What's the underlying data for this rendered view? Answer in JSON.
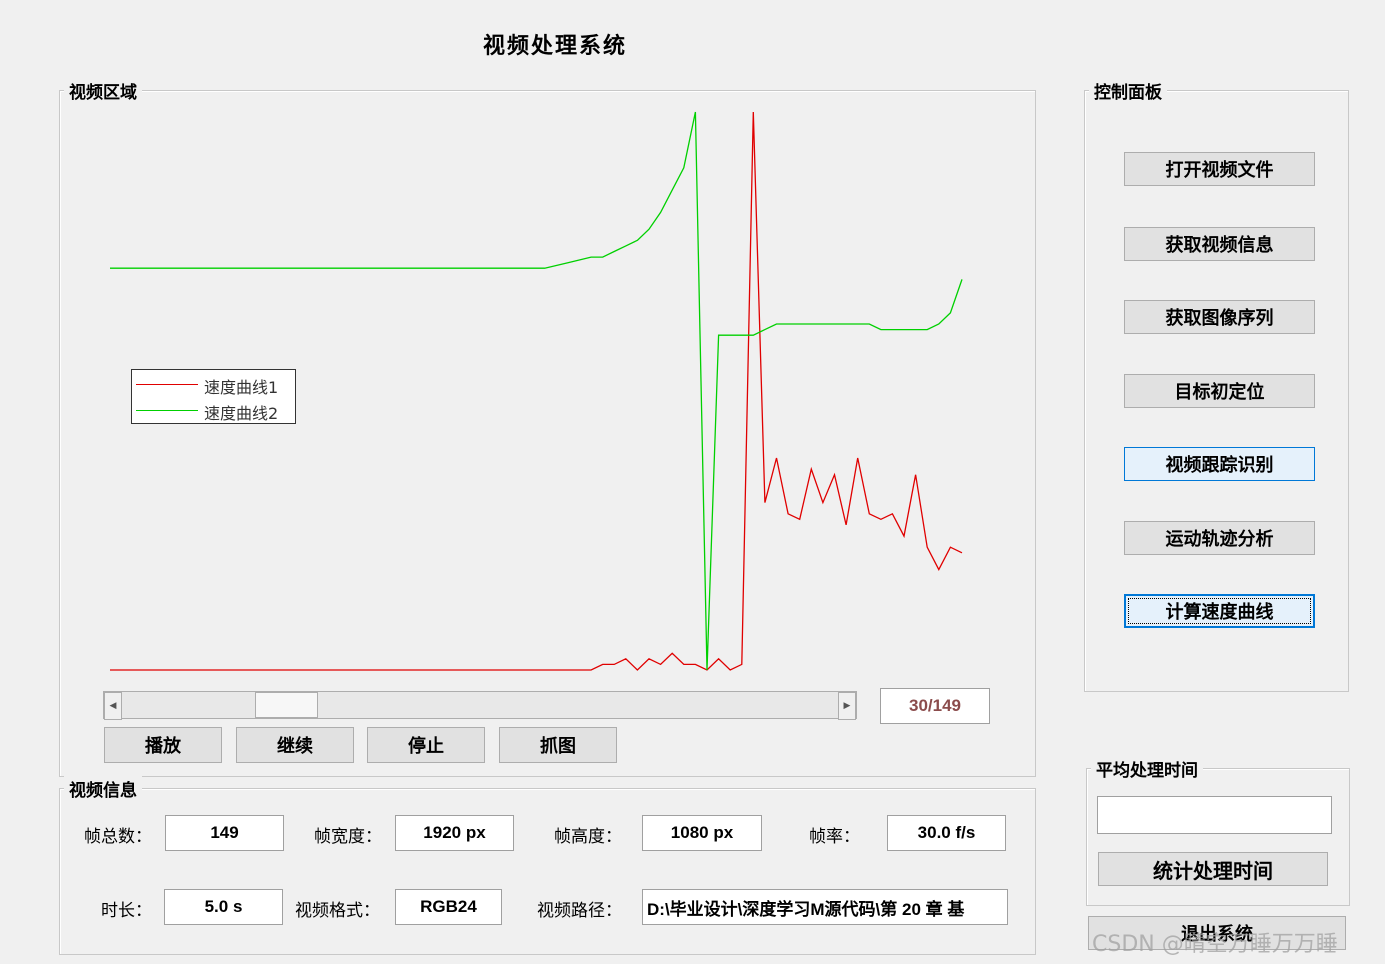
{
  "window_title": "视频处理系统",
  "video_area": {
    "label": "视频区域",
    "chart_data": {
      "type": "line",
      "title": "",
      "xlabel": "",
      "ylabel": "",
      "x": [
        1,
        4,
        8,
        12,
        16,
        20,
        24,
        28,
        32,
        36,
        40,
        44,
        48,
        52,
        56,
        60,
        64,
        68,
        72,
        76,
        80,
        84,
        86,
        88,
        90,
        92,
        94,
        96,
        98,
        100,
        102,
        104,
        106,
        108,
        110,
        112,
        114,
        116,
        118,
        120,
        122,
        124,
        126,
        128,
        130,
        132,
        134,
        136,
        138,
        140,
        142,
        144,
        146,
        148
      ],
      "legend_position": "left",
      "series": [
        {
          "name": "速度曲线1",
          "color": "#e00000",
          "y": [
            0,
            0,
            0,
            0,
            0,
            0,
            0,
            0,
            0,
            0,
            0,
            0,
            0,
            0,
            0,
            0,
            0,
            0,
            0,
            0,
            0,
            0,
            1,
            1,
            2,
            0,
            2,
            1,
            3,
            1,
            1,
            0,
            2,
            0,
            1,
            100,
            30,
            38,
            28,
            27,
            36,
            30,
            35,
            26,
            38,
            28,
            27,
            28,
            24,
            35,
            22,
            18,
            22,
            21
          ]
        },
        {
          "name": "速度曲线2",
          "color": "#00d000",
          "y": [
            72,
            72,
            72,
            72,
            72,
            72,
            72,
            72,
            72,
            72,
            72,
            72,
            72,
            72,
            72,
            72,
            72,
            72,
            72,
            72,
            73,
            74,
            74,
            75,
            76,
            77,
            79,
            82,
            86,
            90,
            100,
            0,
            60,
            60,
            60,
            60,
            61,
            62,
            62,
            62,
            62,
            62,
            62,
            62,
            62,
            62,
            61,
            61,
            61,
            61,
            61,
            62,
            64,
            70
          ]
        }
      ]
    },
    "slider": {
      "value_fraction": 0.2,
      "readout": "30/149"
    },
    "buttons": {
      "play": "播放",
      "resume": "继续",
      "stop": "停止",
      "capture": "抓图"
    }
  },
  "video_info": {
    "label": "视频信息",
    "total_frames_label": "帧总数：",
    "total_frames": "149",
    "frame_width_label": "帧宽度：",
    "frame_width": "1920 px",
    "frame_height_label": "帧高度：",
    "frame_height": "1080 px",
    "frame_rate_label": "帧率：",
    "frame_rate": "30.0 f/s",
    "duration_label": "时长：",
    "duration": "5.0 s",
    "format_label": "视频格式：",
    "format": "RGB24",
    "path_label": "视频路径：",
    "path": "D:\\毕业设计\\深度学习M源代码\\第 20 章 基"
  },
  "control_panel": {
    "label": "控制面板",
    "buttons": [
      "打开视频文件",
      "获取视频信息",
      "获取图像序列",
      "目标初定位",
      "视频跟踪识别",
      "运动轨迹分析",
      "计算速度曲线"
    ]
  },
  "avg_time": {
    "label": "平均处理时间",
    "value": "",
    "button": "统计处理时间"
  },
  "exit_button": "退出系统",
  "watermark": "CSDN @晴空万睡万万睡"
}
